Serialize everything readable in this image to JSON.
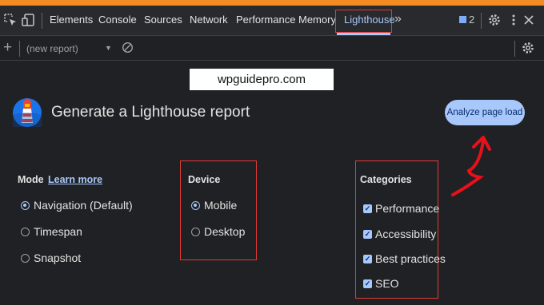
{
  "devtools": {
    "tabs": [
      "Elements",
      "Console",
      "Sources",
      "Network",
      "Performance",
      "Memory",
      "Lighthouse"
    ],
    "active_tab": "Lighthouse",
    "issues_count": "2",
    "icons": {
      "inspect": "inspect-element-icon",
      "device": "device-toolbar-icon",
      "more_tabs": "chevron-double-right-icon",
      "issues": "issues-flag-icon",
      "settings": "gear-icon",
      "menu": "kebab-menu-icon",
      "close": "close-icon"
    }
  },
  "toolbar": {
    "add_label": "+",
    "report_select": "(new report)",
    "clear_icon": "clear-icon",
    "settings_icon": "gear-icon"
  },
  "watermark": "wpguidepro.com",
  "header": {
    "title": "Generate a Lighthouse report",
    "analyze_button": "Analyze page load",
    "logo": "lighthouse-logo"
  },
  "mode": {
    "label": "Mode",
    "learn_more": "Learn more",
    "options": [
      "Navigation (Default)",
      "Timespan",
      "Snapshot"
    ],
    "selected": "Navigation (Default)"
  },
  "device": {
    "label": "Device",
    "options": [
      "Mobile",
      "Desktop"
    ],
    "selected": "Mobile"
  },
  "categories": {
    "label": "Categories",
    "options": [
      "Performance",
      "Accessibility",
      "Best practices",
      "SEO"
    ],
    "checked": [
      true,
      true,
      true,
      true
    ]
  },
  "colors": {
    "accent": "#a8c7fa",
    "highlight_box": "#e53935",
    "top_strip": "#f28b21",
    "background": "#202124"
  }
}
